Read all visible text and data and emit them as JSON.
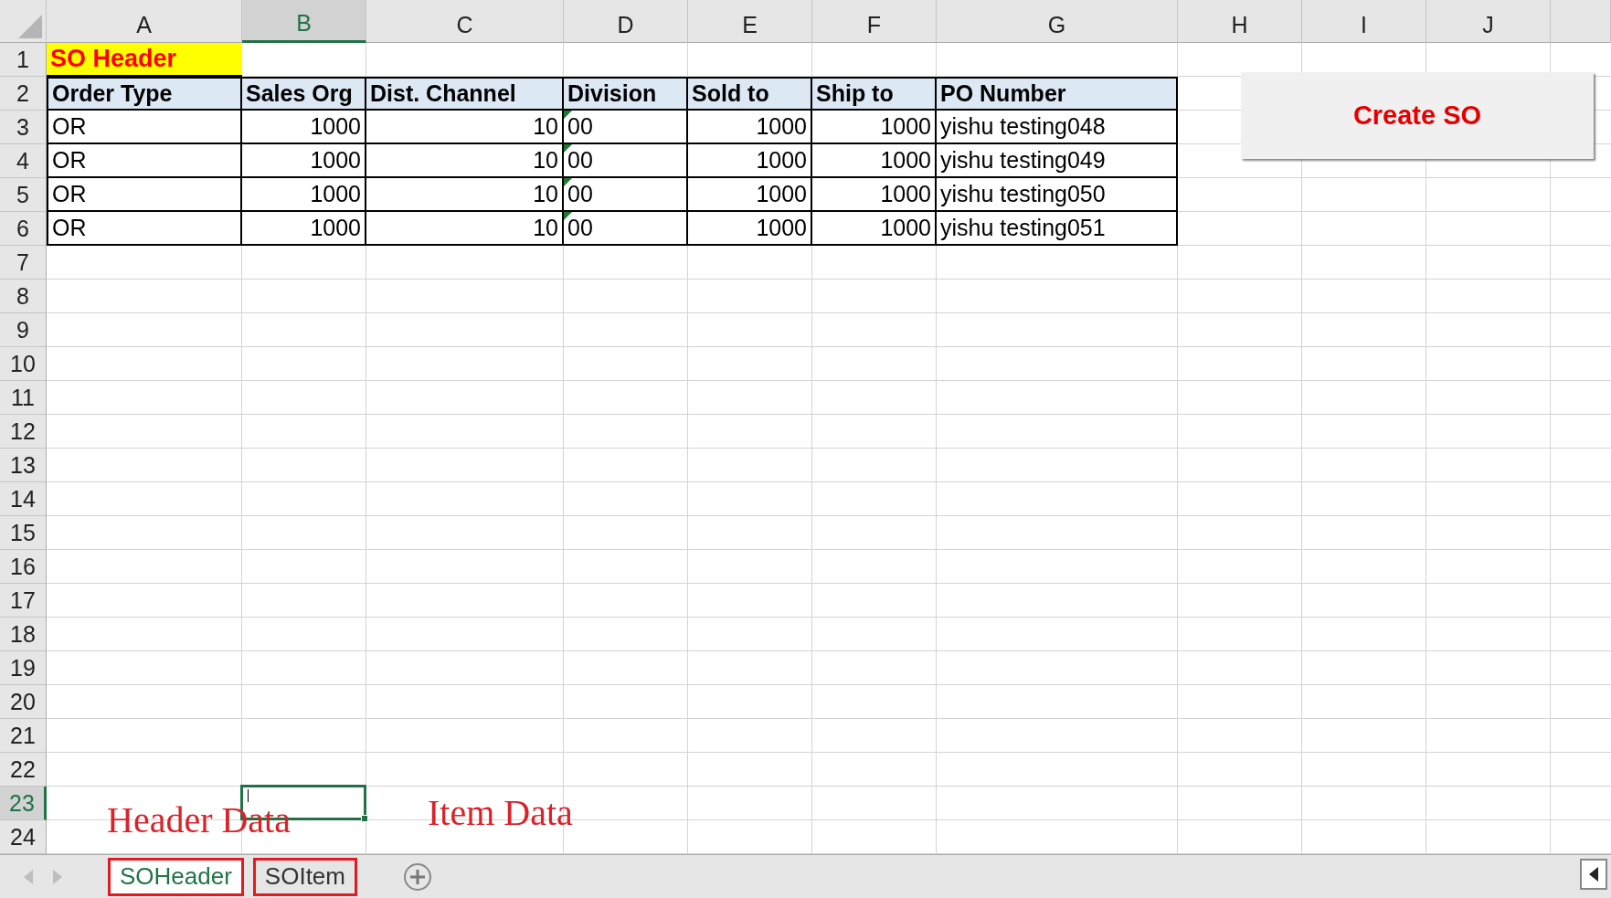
{
  "columns": [
    {
      "label": "A",
      "selected": false
    },
    {
      "label": "B",
      "selected": true
    },
    {
      "label": "C",
      "selected": false
    },
    {
      "label": "D",
      "selected": false
    },
    {
      "label": "E",
      "selected": false
    },
    {
      "label": "F",
      "selected": false
    },
    {
      "label": "G",
      "selected": false
    },
    {
      "label": "H",
      "selected": false
    },
    {
      "label": "I",
      "selected": false
    },
    {
      "label": "J",
      "selected": false
    }
  ],
  "rows": [
    {
      "label": "1",
      "selected": false
    },
    {
      "label": "2",
      "selected": false
    },
    {
      "label": "3",
      "selected": false
    },
    {
      "label": "4",
      "selected": false
    },
    {
      "label": "5",
      "selected": false
    },
    {
      "label": "6",
      "selected": false
    },
    {
      "label": "7",
      "selected": false
    },
    {
      "label": "8",
      "selected": false
    },
    {
      "label": "9",
      "selected": false
    },
    {
      "label": "10",
      "selected": false
    },
    {
      "label": "11",
      "selected": false
    },
    {
      "label": "12",
      "selected": false
    },
    {
      "label": "13",
      "selected": false
    },
    {
      "label": "14",
      "selected": false
    },
    {
      "label": "15",
      "selected": false
    },
    {
      "label": "16",
      "selected": false
    },
    {
      "label": "17",
      "selected": false
    },
    {
      "label": "18",
      "selected": false
    },
    {
      "label": "19",
      "selected": false
    },
    {
      "label": "20",
      "selected": false
    },
    {
      "label": "21",
      "selected": false
    },
    {
      "label": "22",
      "selected": false
    },
    {
      "label": "23",
      "selected": true
    },
    {
      "label": "24",
      "selected": false
    }
  ],
  "title_cell": "SO Header",
  "table": {
    "columns": [
      {
        "label": "Order Type",
        "kind": "text"
      },
      {
        "label": "Sales Org",
        "kind": "number"
      },
      {
        "label": "Dist. Channel",
        "kind": "number"
      },
      {
        "label": "Division",
        "kind": "number_as_text"
      },
      {
        "label": "Sold to",
        "kind": "number"
      },
      {
        "label": "Ship to",
        "kind": "number"
      },
      {
        "label": "PO Number",
        "kind": "text"
      }
    ],
    "rows": [
      {
        "cells": [
          "OR",
          "1000",
          "10",
          "00",
          "1000",
          "1000",
          "yishu testing048"
        ]
      },
      {
        "cells": [
          "OR",
          "1000",
          "10",
          "00",
          "1000",
          "1000",
          "yishu testing049"
        ]
      },
      {
        "cells": [
          "OR",
          "1000",
          "10",
          "00",
          "1000",
          "1000",
          "yishu testing050"
        ]
      },
      {
        "cells": [
          "OR",
          "1000",
          "10",
          "00",
          "1000",
          "1000",
          "yishu testing051"
        ]
      }
    ]
  },
  "create_button": "Create SO",
  "annotations": [
    {
      "text": "Header Data"
    },
    {
      "text": "Item Data"
    }
  ],
  "sheet_tabs": [
    {
      "label": "SOHeader",
      "selected": true,
      "highlighted": true
    },
    {
      "label": "SOItem",
      "selected": false,
      "highlighted": true
    }
  ]
}
